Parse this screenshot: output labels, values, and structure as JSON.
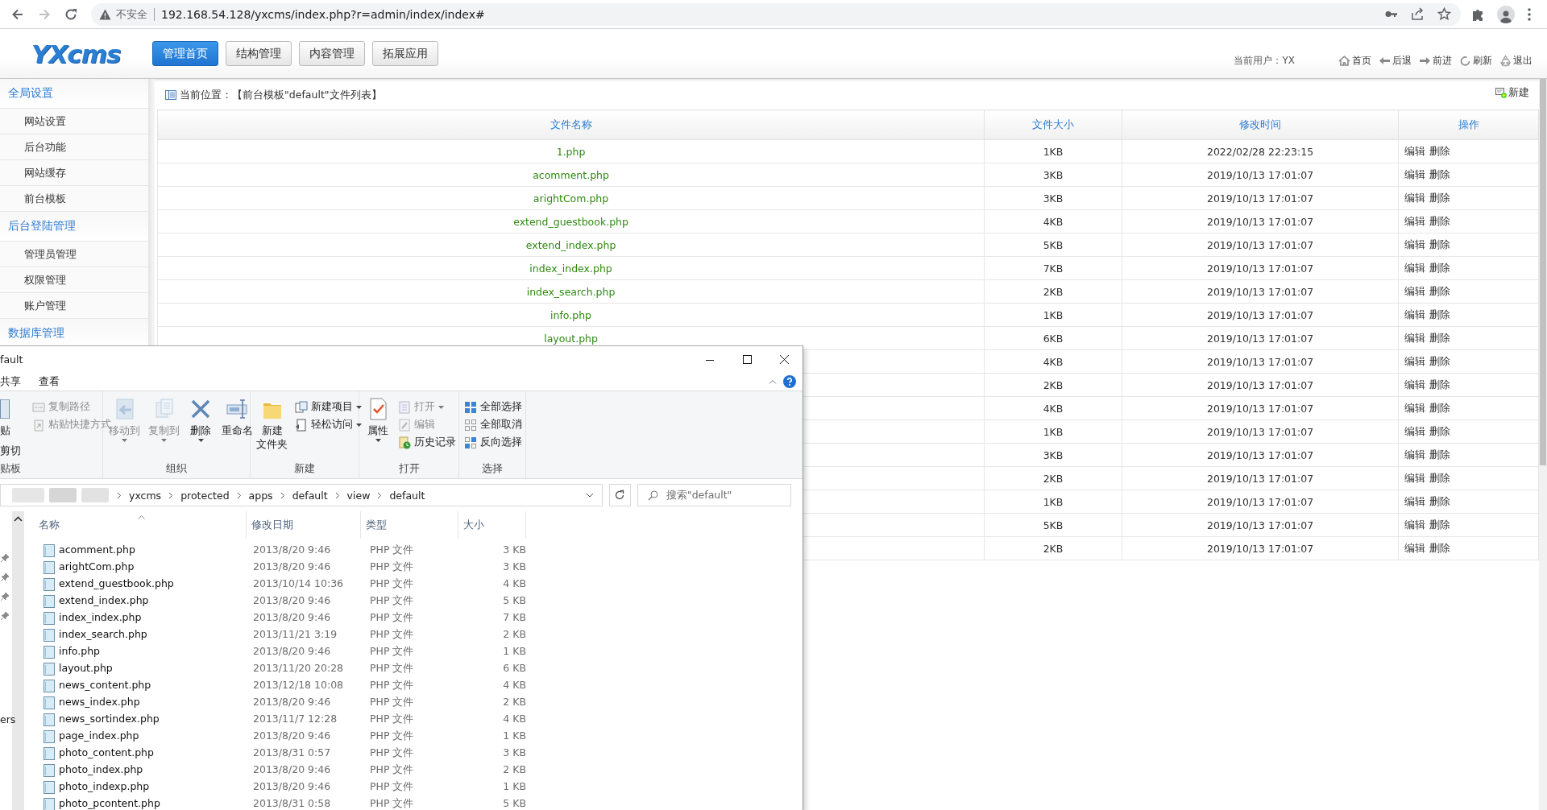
{
  "browser": {
    "security_label": "不安全",
    "url": "192.168.54.128/yxcms/index.php?r=admin/index/index#"
  },
  "header": {
    "logo": "YXcms",
    "nav": [
      {
        "label": "管理首页",
        "selected": true
      },
      {
        "label": "结构管理",
        "selected": false
      },
      {
        "label": "内容管理",
        "selected": false
      },
      {
        "label": "拓展应用",
        "selected": false
      }
    ],
    "current_user": "当前用户：YX",
    "links": [
      "首页",
      "后退",
      "前进",
      "刷新",
      "退出"
    ]
  },
  "sidebar": {
    "groups": [
      {
        "title": "全局设置",
        "items": [
          "网站设置",
          "后台功能",
          "网站缓存",
          "前台模板"
        ]
      },
      {
        "title": "后台登陆管理",
        "items": [
          "管理员管理",
          "权限管理",
          "账户管理"
        ]
      },
      {
        "title": "数据库管理"
      }
    ]
  },
  "content": {
    "breadcrumb": "当前位置：【前台模板\"default\"文件列表】",
    "new_button": "新建",
    "table": {
      "columns": [
        "文件名称",
        "文件大小",
        "修改时间",
        "操作"
      ],
      "rows": [
        {
          "name": "1.php",
          "size": "1KB",
          "modified": "2022/02/28 22:23:15",
          "actions": [
            "编辑",
            "删除"
          ]
        },
        {
          "name": "acomment.php",
          "size": "3KB",
          "modified": "2019/10/13 17:01:07",
          "actions": [
            "编辑",
            "删除"
          ]
        },
        {
          "name": "arightCom.php",
          "size": "3KB",
          "modified": "2019/10/13 17:01:07",
          "actions": [
            "编辑",
            "删除"
          ]
        },
        {
          "name": "extend_guestbook.php",
          "size": "4KB",
          "modified": "2019/10/13 17:01:07",
          "actions": [
            "编辑",
            "删除"
          ]
        },
        {
          "name": "extend_index.php",
          "size": "5KB",
          "modified": "2019/10/13 17:01:07",
          "actions": [
            "编辑",
            "删除"
          ]
        },
        {
          "name": "index_index.php",
          "size": "7KB",
          "modified": "2019/10/13 17:01:07",
          "actions": [
            "编辑",
            "删除"
          ]
        },
        {
          "name": "index_search.php",
          "size": "2KB",
          "modified": "2019/10/13 17:01:07",
          "actions": [
            "编辑",
            "删除"
          ]
        },
        {
          "name": "info.php",
          "size": "1KB",
          "modified": "2019/10/13 17:01:07",
          "actions": [
            "编辑",
            "删除"
          ]
        },
        {
          "name": "layout.php",
          "size": "6KB",
          "modified": "2019/10/13 17:01:07",
          "actions": [
            "编辑",
            "删除"
          ]
        },
        {
          "size": "4KB",
          "modified": "2019/10/13 17:01:07",
          "actions": [
            "编辑",
            "删除"
          ]
        },
        {
          "size": "2KB",
          "modified": "2019/10/13 17:01:07",
          "actions": [
            "编辑",
            "删除"
          ]
        },
        {
          "size": "4KB",
          "modified": "2019/10/13 17:01:07",
          "actions": [
            "编辑",
            "删除"
          ]
        },
        {
          "size": "1KB",
          "modified": "2019/10/13 17:01:07",
          "actions": [
            "编辑",
            "删除"
          ]
        },
        {
          "size": "3KB",
          "modified": "2019/10/13 17:01:07",
          "actions": [
            "编辑",
            "删除"
          ]
        },
        {
          "size": "2KB",
          "modified": "2019/10/13 17:01:07",
          "actions": [
            "编辑",
            "删除"
          ]
        },
        {
          "size": "1KB",
          "modified": "2019/10/13 17:01:07",
          "actions": [
            "编辑",
            "删除"
          ]
        },
        {
          "size": "5KB",
          "modified": "2019/10/13 17:01:07",
          "actions": [
            "编辑",
            "删除"
          ]
        },
        {
          "size": "2KB",
          "modified": "2019/10/13 17:01:07",
          "actions": [
            "编辑",
            "删除"
          ]
        }
      ]
    }
  },
  "explorer": {
    "title": "fault",
    "ribbon_tabs": [
      {
        "label": "共享",
        "selected": false
      },
      {
        "label": "查看",
        "selected": false
      }
    ],
    "ribbon_groups": [
      {
        "label": "贴板",
        "columns": [
          [
            {
              "label": "贴",
              "kind": "large",
              "disabled": false,
              "dropdown": false
            },
            {
              "label": "剪切",
              "kind": "label-only",
              "disabled": false
            }
          ],
          [
            {
              "label": "复制路径",
              "kind": "small",
              "disabled": true,
              "dropdown": false
            },
            {
              "label": "粘贴快捷方式",
              "kind": "small",
              "disabled": true,
              "dropdown": false
            }
          ]
        ]
      },
      {
        "label": "组织",
        "columns": [
          [
            {
              "label": "移动到",
              "kind": "large",
              "disabled": true,
              "dropdown": true
            }
          ],
          [
            {
              "label": "复制到",
              "kind": "large",
              "disabled": true,
              "dropdown": true
            }
          ],
          [
            {
              "label": "删除",
              "kind": "large",
              "disabled": false,
              "dropdown": true
            }
          ],
          [
            {
              "label": "重命名",
              "kind": "large",
              "disabled": false,
              "dropdown": false
            }
          ]
        ]
      },
      {
        "label": "新建",
        "columns": [
          [
            {
              "label_lines": [
                "新建",
                "文件夹"
              ],
              "kind": "large",
              "disabled": false,
              "dropdown": false
            }
          ],
          [
            {
              "label": "新建项目",
              "kind": "small",
              "disabled": false,
              "dropdown": true
            },
            {
              "label": "轻松访问",
              "kind": "small",
              "disabled": false,
              "dropdown": true
            }
          ]
        ]
      },
      {
        "label": "打开",
        "columns": [
          [
            {
              "label": "属性",
              "kind": "large",
              "disabled": false,
              "dropdown": true
            }
          ],
          [
            {
              "label": "打开",
              "kind": "small",
              "disabled": true,
              "dropdown": true
            },
            {
              "label": "编辑",
              "kind": "small",
              "disabled": true,
              "dropdown": false
            },
            {
              "label": "历史记录",
              "kind": "small",
              "disabled": false,
              "dropdown": false
            }
          ]
        ]
      },
      {
        "label": "选择",
        "columns": [
          [
            {
              "label": "全部选择",
              "kind": "small",
              "disabled": false,
              "dropdown": false
            },
            {
              "label": "全部取消",
              "kind": "small",
              "disabled": false,
              "dropdown": false
            },
            {
              "label": "反向选择",
              "kind": "small",
              "disabled": false,
              "dropdown": false
            }
          ]
        ]
      }
    ],
    "path": [
      "yxcms",
      "protected",
      "apps",
      "default",
      "view",
      "default"
    ],
    "search_placeholder": "搜索\"default\"",
    "nav_pane_text": "ers",
    "columns": [
      "名称",
      "修改日期",
      "类型",
      "大小"
    ],
    "files": [
      {
        "name": "acomment.php",
        "modified": "2013/8/20 9:46",
        "type": "PHP 文件",
        "size": "3 KB"
      },
      {
        "name": "arightCom.php",
        "modified": "2013/8/20 9:46",
        "type": "PHP 文件",
        "size": "3 KB"
      },
      {
        "name": "extend_guestbook.php",
        "modified": "2013/10/14 10:36",
        "type": "PHP 文件",
        "size": "4 KB"
      },
      {
        "name": "extend_index.php",
        "modified": "2013/8/20 9:46",
        "type": "PHP 文件",
        "size": "5 KB"
      },
      {
        "name": "index_index.php",
        "modified": "2013/8/20 9:46",
        "type": "PHP 文件",
        "size": "7 KB"
      },
      {
        "name": "index_search.php",
        "modified": "2013/11/21 3:19",
        "type": "PHP 文件",
        "size": "2 KB"
      },
      {
        "name": "info.php",
        "modified": "2013/8/20 9:46",
        "type": "PHP 文件",
        "size": "1 KB"
      },
      {
        "name": "layout.php",
        "modified": "2013/11/20 20:28",
        "type": "PHP 文件",
        "size": "6 KB"
      },
      {
        "name": "news_content.php",
        "modified": "2013/12/18 10:08",
        "type": "PHP 文件",
        "size": "4 KB"
      },
      {
        "name": "news_index.php",
        "modified": "2013/8/20 9:46",
        "type": "PHP 文件",
        "size": "2 KB"
      },
      {
        "name": "news_sortindex.php",
        "modified": "2013/11/7 12:28",
        "type": "PHP 文件",
        "size": "4 KB"
      },
      {
        "name": "page_index.php",
        "modified": "2013/8/20 9:46",
        "type": "PHP 文件",
        "size": "1 KB"
      },
      {
        "name": "photo_content.php",
        "modified": "2013/8/31 0:57",
        "type": "PHP 文件",
        "size": "3 KB"
      },
      {
        "name": "photo_index.php",
        "modified": "2013/8/20 9:46",
        "type": "PHP 文件",
        "size": "2 KB"
      },
      {
        "name": "photo_indexp.php",
        "modified": "2013/8/20 9:46",
        "type": "PHP 文件",
        "size": "1 KB"
      },
      {
        "name": "photo_pcontent.php",
        "modified": "2013/8/31 0:58",
        "type": "PHP 文件",
        "size": "5 KB"
      }
    ]
  }
}
